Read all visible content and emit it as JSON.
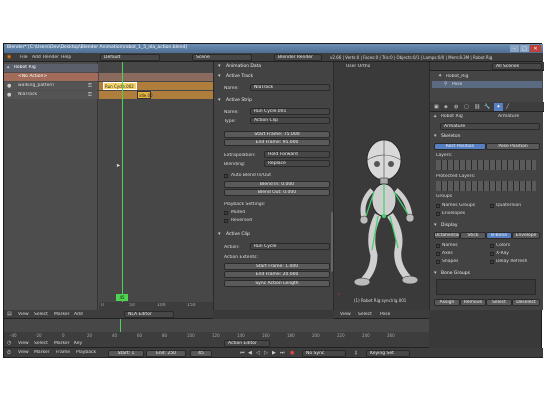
{
  "window": {
    "title": "Blender* [C:\\Users\\Dev\\Desktop\\Blender Animation\\robot_1_5_nla_action.blend]"
  },
  "topbar": {
    "menu": [
      "File",
      "Add",
      "Render",
      "Help"
    ],
    "layout": "Default",
    "scene": "Scene",
    "engine": "Blender Render",
    "stats": "v2.66 | Verts:0 | Faces:0 | Tris:0 | Objects:0/1 | Lamps:0/0 | Mem:8.3M | Robot Rig"
  },
  "nla": {
    "tracks": [
      {
        "name": "Robot Rig",
        "kind": "object"
      },
      {
        "name": "<No Action>",
        "kind": "action"
      },
      {
        "name": "walking_pattern",
        "kind": "track"
      },
      {
        "name": "NlaTrack",
        "kind": "track"
      }
    ],
    "strips": [
      {
        "label": "Run Cycle.002"
      },
      {
        "label": "idle.00"
      }
    ],
    "frame_marker": "45",
    "ruler": [
      "0",
      "50",
      "100",
      "150"
    ],
    "header": {
      "menu": [
        "View",
        "Select",
        "Marker",
        "Add"
      ],
      "mode": "NLA Editor"
    }
  },
  "props": {
    "title": "Animation Data",
    "active_track": {
      "label": "Active Track",
      "name_label": "Name:",
      "name_value": "NlaTrack"
    },
    "active_strip": {
      "label": "Active Strip",
      "name_label": "Name:",
      "name_value": "Run Cycle.001",
      "type_label": "Type:",
      "type_value": "Action Clip",
      "start": "Start Frame: 75.000",
      "end": "End Frame: 95.000",
      "extrapolation_label": "Extrapolation:",
      "extrapolation_value": "Hold Forward",
      "blending_label": "Blending:",
      "blending_value": "Replace",
      "auto_blend": "Auto Blend In/Out",
      "blend_in": "Blend In: 0.000",
      "blend_out": "Blend Out: 0.000",
      "settings_label": "Playback Settings:",
      "muted": "Muted",
      "reversed": "Reversed"
    },
    "active_clip": {
      "label": "Active Clip",
      "action_label": "Action:",
      "action_value": "Run Cycle",
      "extents_label": "Action Extents:",
      "start": "Start Frame: 1.000",
      "end": "End Frame: 20.000",
      "sync": "Sync Action Length"
    }
  },
  "viewport": {
    "label": "User Ortho",
    "object": "(1) Robot Rig:sync/rig.001",
    "header": [
      "View",
      "Select",
      "Pose"
    ]
  },
  "outliner": {
    "search": "All Scenes",
    "items": [
      {
        "label": "Robot_Rig"
      },
      {
        "label": "Pose"
      }
    ]
  },
  "armature": {
    "object": "Robot Rig",
    "name": "Armature",
    "breadcrumb": "Armature",
    "skeleton": {
      "label": "Skeleton",
      "buttons": [
        "Rest Position",
        "Pose Position"
      ],
      "layers_label": "Layers:",
      "protected_label": "Protected Layers:"
    },
    "groups": {
      "label": "Groups"
    },
    "display": {
      "label": "Display",
      "buttons": [
        "Octahedral",
        "Stick",
        "B-Bone",
        "Envelope"
      ],
      "checks": [
        "Names",
        "Colors",
        "Axes",
        "X-Ray",
        "Shapes",
        "Delay Refresh"
      ]
    },
    "bone_groups": {
      "label": "Bone Groups",
      "buttons": [
        "Assign",
        "Remove",
        "Select",
        "Deselect"
      ]
    },
    "checks_groups": [
      "Names Groups",
      "Envelopes",
      "Quaternion"
    ]
  },
  "timeline": {
    "menu": [
      "View",
      "Marker",
      "Frame",
      "Playback"
    ],
    "start": "Start: 1",
    "end": "End: 250",
    "frame": "45",
    "sync": "No Sync",
    "keying": "Keying Set",
    "ticks": [
      "-40",
      "-20",
      "0",
      "20",
      "40",
      "60",
      "80",
      "100",
      "120",
      "140",
      "160",
      "180",
      "200",
      "220",
      "240",
      "260"
    ]
  },
  "dopesheet": {
    "menu": [
      "View",
      "Select",
      "Marker",
      "Key"
    ],
    "mode": "Action Editor"
  },
  "colors": {
    "nla_strip": "#e8b43c",
    "active_strip": "#f4d26a",
    "playhead": "#4fd44f",
    "panel": "#434343"
  }
}
